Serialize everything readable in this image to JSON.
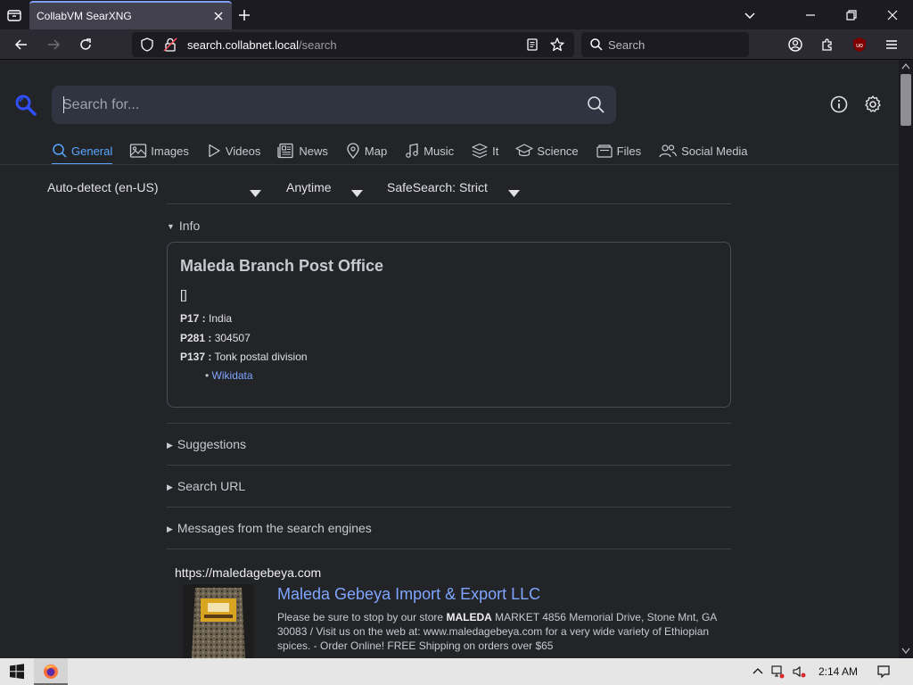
{
  "browser": {
    "tab_title": "CollabVM SearXNG",
    "url_host": "search.collabnet.local",
    "url_path": "/search",
    "search_placeholder": "Search"
  },
  "page": {
    "search_placeholder": "Search for...",
    "categories": [
      {
        "label": "General",
        "icon": "magnifier-icon",
        "active": true
      },
      {
        "label": "Images",
        "icon": "image-icon"
      },
      {
        "label": "Videos",
        "icon": "play-icon"
      },
      {
        "label": "News",
        "icon": "newspaper-icon"
      },
      {
        "label": "Map",
        "icon": "map-pin-icon"
      },
      {
        "label": "Music",
        "icon": "music-note-icon"
      },
      {
        "label": "It",
        "icon": "layers-icon"
      },
      {
        "label": "Science",
        "icon": "graduation-cap-icon"
      },
      {
        "label": "Files",
        "icon": "files-icon"
      },
      {
        "label": "Social Media",
        "icon": "people-icon"
      }
    ],
    "filters": {
      "language": "Auto-detect (en-US)",
      "time": "Anytime",
      "safesearch": "SafeSearch: Strict"
    },
    "info": {
      "toggle_label": "Info",
      "title": "Maleda Branch Post Office",
      "brackets": "[]",
      "rows": [
        {
          "key": "P17 :",
          "value": "India"
        },
        {
          "key": "P281 :",
          "value": "304507"
        },
        {
          "key": "P137 :",
          "value": "Tonk postal division"
        }
      ],
      "link_label": "Wikidata"
    },
    "sections": {
      "suggestions": "Suggestions",
      "search_url": "Search URL",
      "messages": "Messages from the search engines"
    },
    "result": {
      "url": "https://maledagebeya.com",
      "title": "Maleda Gebeya Import & Export LLC",
      "snippet_before": "Please be sure to stop by our store ",
      "snippet_bold": "MALEDA",
      "snippet_after": " MARKET 4856 Memorial Drive, Stone Mnt, GA 30083 / Visit us on the web at: www.maledagebeya.com for a very wide variety of Ethiopian spices. - Order Online! FREE Shipping on orders over $65"
    }
  },
  "taskbar": {
    "clock": "2:14 AM"
  },
  "colors": {
    "accent": "#58a6ff",
    "link": "#7fa6ff",
    "page_bg": "#222428"
  }
}
